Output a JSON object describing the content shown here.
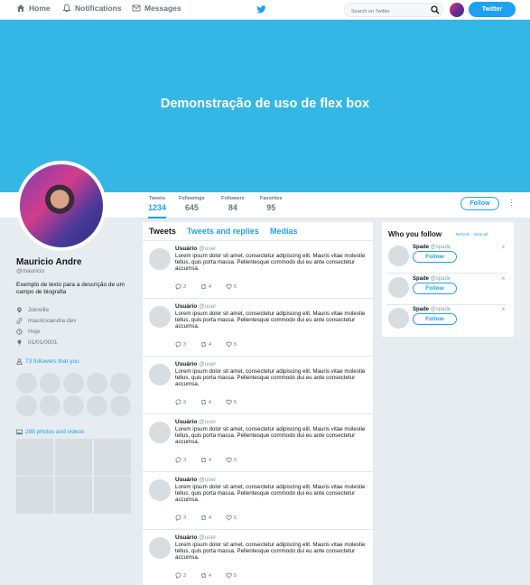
{
  "nav": {
    "home": "Home",
    "notifications": "Notifications",
    "messages": "Messages",
    "search_placeholder": "Search on Twitter",
    "tweet_button": "Twitter"
  },
  "banner": {
    "title": "Demonstração de uso de flex box"
  },
  "stats": [
    {
      "label": "Tweets",
      "value": "1234"
    },
    {
      "label": "Followings",
      "value": "645"
    },
    {
      "label": "Followers",
      "value": "84"
    },
    {
      "label": "Favorites",
      "value": "95"
    }
  ],
  "profile_actions": {
    "follow": "Follow"
  },
  "profile": {
    "name": "Mauricio Andre",
    "handle": "@mauricio",
    "bio": "Exemplo de texto para a descrição de um campo de biografia",
    "location": "Joinville",
    "website": "mauricioandre.dev",
    "joined": "Hoje",
    "birthday": "01/01/0001",
    "followers_link": "73 followers that you",
    "photos_link": "288 photos and videos"
  },
  "timeline": {
    "tabs": [
      "Tweets",
      "Tweets and replies",
      "Medias"
    ],
    "tweets": [
      {
        "name": "Usuário",
        "handle": "@user",
        "text": "Lorem ipsum dolor sit amet, consectetur adipiscing elit. Mauris vitae molestie tellus, quis porta massa. Pellentesque commodo dui eu ante consectetur accumsa.",
        "replies": "3",
        "retweets": "4",
        "likes": "5"
      },
      {
        "name": "Usuário",
        "handle": "@user",
        "text": "Lorem ipsum dolor sit amet, consectetur adipiscing elit. Mauris vitae molestie tellus, quis porta massa. Pellentesque commodo dui eu ante consectetur accumsa.",
        "replies": "3",
        "retweets": "4",
        "likes": "5"
      },
      {
        "name": "Usuário",
        "handle": "@user",
        "text": "Lorem ipsum dolor sit amet, consectetur adipiscing elit. Mauris vitae molestie tellus, quis porta massa. Pellentesque commodo dui eu ante consectetur accumsa.",
        "replies": "3",
        "retweets": "4",
        "likes": "5"
      },
      {
        "name": "Usuário",
        "handle": "@user",
        "text": "Lorem ipsum dolor sit amet, consectetur adipiscing elit. Mauris vitae molestie tellus, quis porta massa. Pellentesque commodo dui eu ante consectetur accumsa.",
        "replies": "3",
        "retweets": "4",
        "likes": "5"
      },
      {
        "name": "Usuário",
        "handle": "@user",
        "text": "Lorem ipsum dolor sit amet, consectetur adipiscing elit. Mauris vitae molestie tellus, quis porta massa. Pellentesque commodo dui eu ante consectetur accumsa.",
        "replies": "3",
        "retweets": "4",
        "likes": "5"
      },
      {
        "name": "Usuário",
        "handle": "@user",
        "text": "Lorem ipsum dolor sit amet, consectetur adipiscing elit. Mauris vitae molestie tellus, quis porta massa. Pellentesque commodo dui eu ante consectetur accumsa.",
        "replies": "3",
        "retweets": "4",
        "likes": "5"
      }
    ]
  },
  "who_to_follow": {
    "title": "Who you follow",
    "refresh": "Refresh",
    "view_all": "View all",
    "close_glyph": "x",
    "suggestions": [
      {
        "name": "Spade",
        "handle": "@spade",
        "button": "Follow"
      },
      {
        "name": "Spade",
        "handle": "@spade",
        "button": "Follow"
      },
      {
        "name": "Spade",
        "handle": "@spade",
        "button": "Follow"
      }
    ]
  },
  "colors": {
    "accent": "#1da1f2",
    "banner": "#35b7e5",
    "background": "#e6ecf0"
  }
}
